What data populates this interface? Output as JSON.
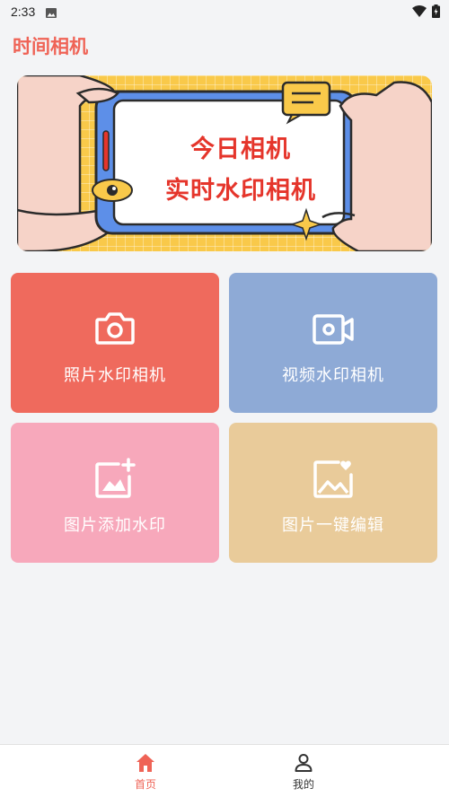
{
  "status_bar": {
    "time": "2:33"
  },
  "header": {
    "title": "时间相机"
  },
  "banner": {
    "line1": "今日相机",
    "line2": "实时水印相机"
  },
  "tiles": [
    {
      "label": "照片水印相机",
      "icon": "camera-icon",
      "color": "#ef6a5d"
    },
    {
      "label": "视频水印相机",
      "icon": "video-camera-icon",
      "color": "#8eaad6"
    },
    {
      "label": "图片添加水印",
      "icon": "image-add-icon",
      "color": "#f7a8bb"
    },
    {
      "label": "图片一键编辑",
      "icon": "image-heart-icon",
      "color": "#e9cb9a"
    }
  ],
  "bottom_nav": {
    "items": [
      {
        "label": "首页",
        "icon": "home-icon",
        "active": true
      },
      {
        "label": "我的",
        "icon": "user-icon",
        "active": false
      }
    ]
  },
  "colors": {
    "accent": "#ef6356",
    "background": "#f3f4f6"
  }
}
